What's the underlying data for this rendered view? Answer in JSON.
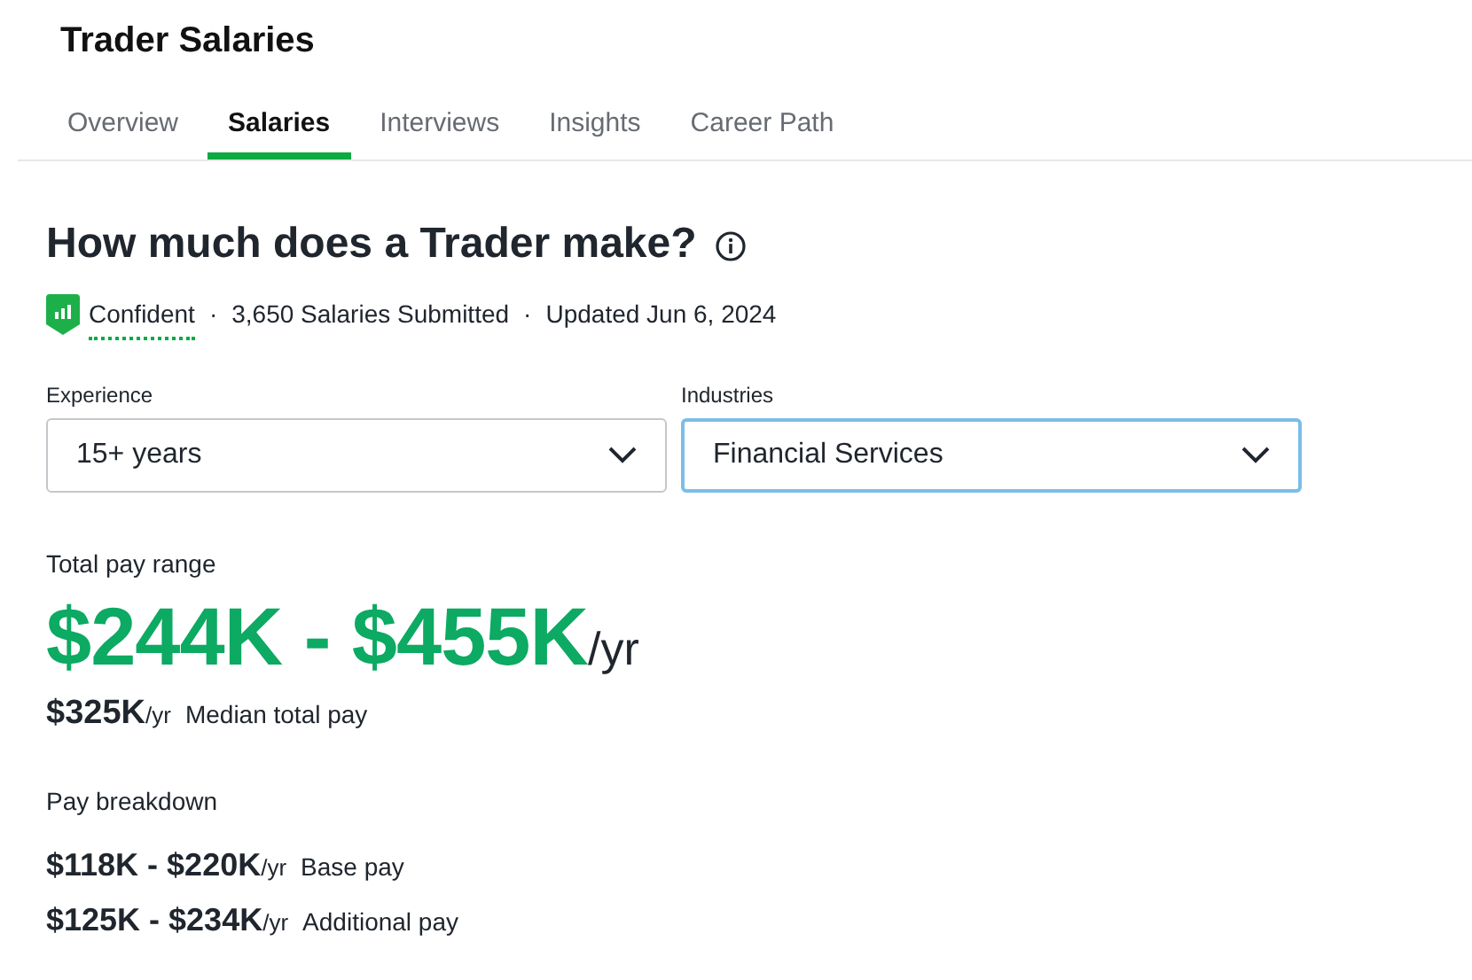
{
  "page_title": "Trader Salaries",
  "tabs": [
    {
      "label": "Overview",
      "selected": false
    },
    {
      "label": "Salaries",
      "selected": true
    },
    {
      "label": "Interviews",
      "selected": false
    },
    {
      "label": "Insights",
      "selected": false
    },
    {
      "label": "Career Path",
      "selected": false
    }
  ],
  "heading": "How much does a Trader make?",
  "meta": {
    "confidence": "Confident",
    "submitted": "3,650 Salaries Submitted",
    "updated": "Updated Jun 6, 2024",
    "separator": "·"
  },
  "filters": [
    {
      "label": "Experience",
      "value": "15+ years",
      "focused": false
    },
    {
      "label": "Industries",
      "value": "Financial Services",
      "focused": true
    }
  ],
  "total": {
    "label": "Total pay range",
    "range": "$244K - $455K",
    "unit": "/yr",
    "median": "$325K",
    "median_unit": "/yr",
    "median_label": "Median total pay"
  },
  "breakdown": {
    "label": "Pay breakdown",
    "rows": [
      {
        "range": "$118K - $220K",
        "unit": "/yr",
        "label": "Base pay"
      },
      {
        "range": "$125K - $234K",
        "unit": "/yr",
        "label": "Additional pay"
      }
    ]
  }
}
